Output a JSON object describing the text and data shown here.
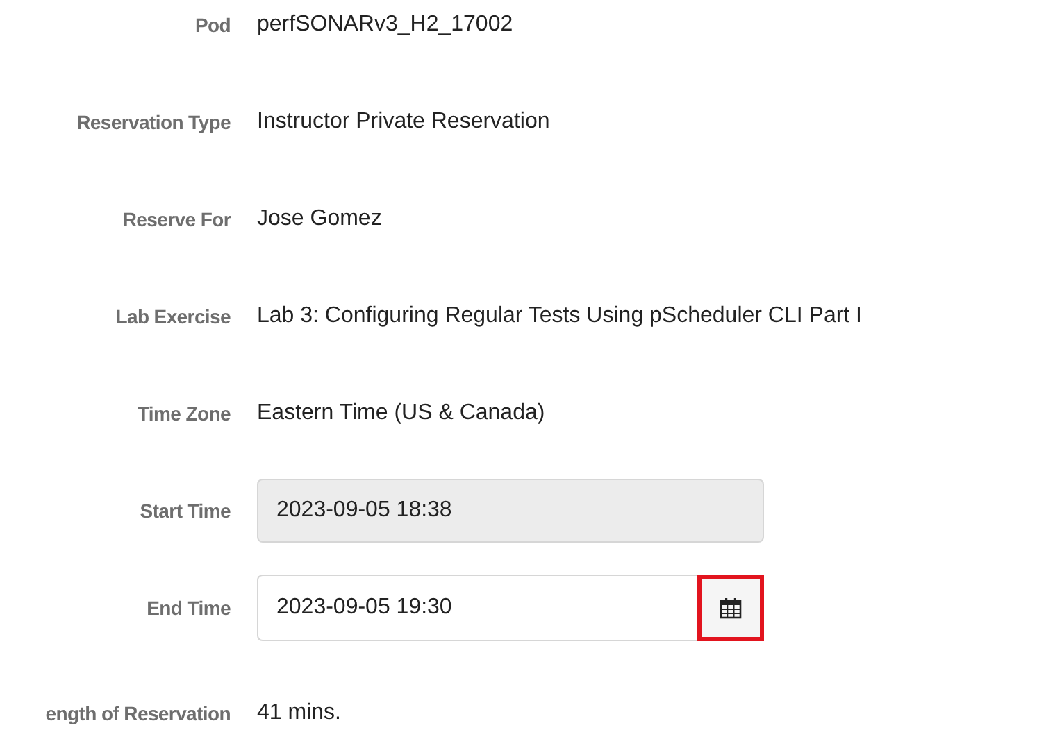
{
  "fields": [
    {
      "kind": "text",
      "label": "Pod",
      "value": "perfSONARv3_H2_17002"
    },
    {
      "kind": "text",
      "label": "Reservation Type",
      "value": "Instructor Private Reservation"
    },
    {
      "kind": "text",
      "label": "Reserve For",
      "value": "Jose Gomez"
    },
    {
      "kind": "text",
      "label": "Lab Exercise",
      "value": "Lab 3: Configuring Regular Tests Using pScheduler CLI Part I"
    },
    {
      "kind": "text",
      "label": "Time Zone",
      "value": "Eastern Time (US & Canada)"
    },
    {
      "kind": "input",
      "label": "Start Time",
      "value": "2023-09-05 18:38",
      "disabled": true
    },
    {
      "kind": "datepicker",
      "label": "End Time",
      "value": "2023-09-05 19:30",
      "disabled": false,
      "highlighted": true
    },
    {
      "kind": "text",
      "label": "ength of Reservation",
      "value": "41 mins."
    }
  ]
}
